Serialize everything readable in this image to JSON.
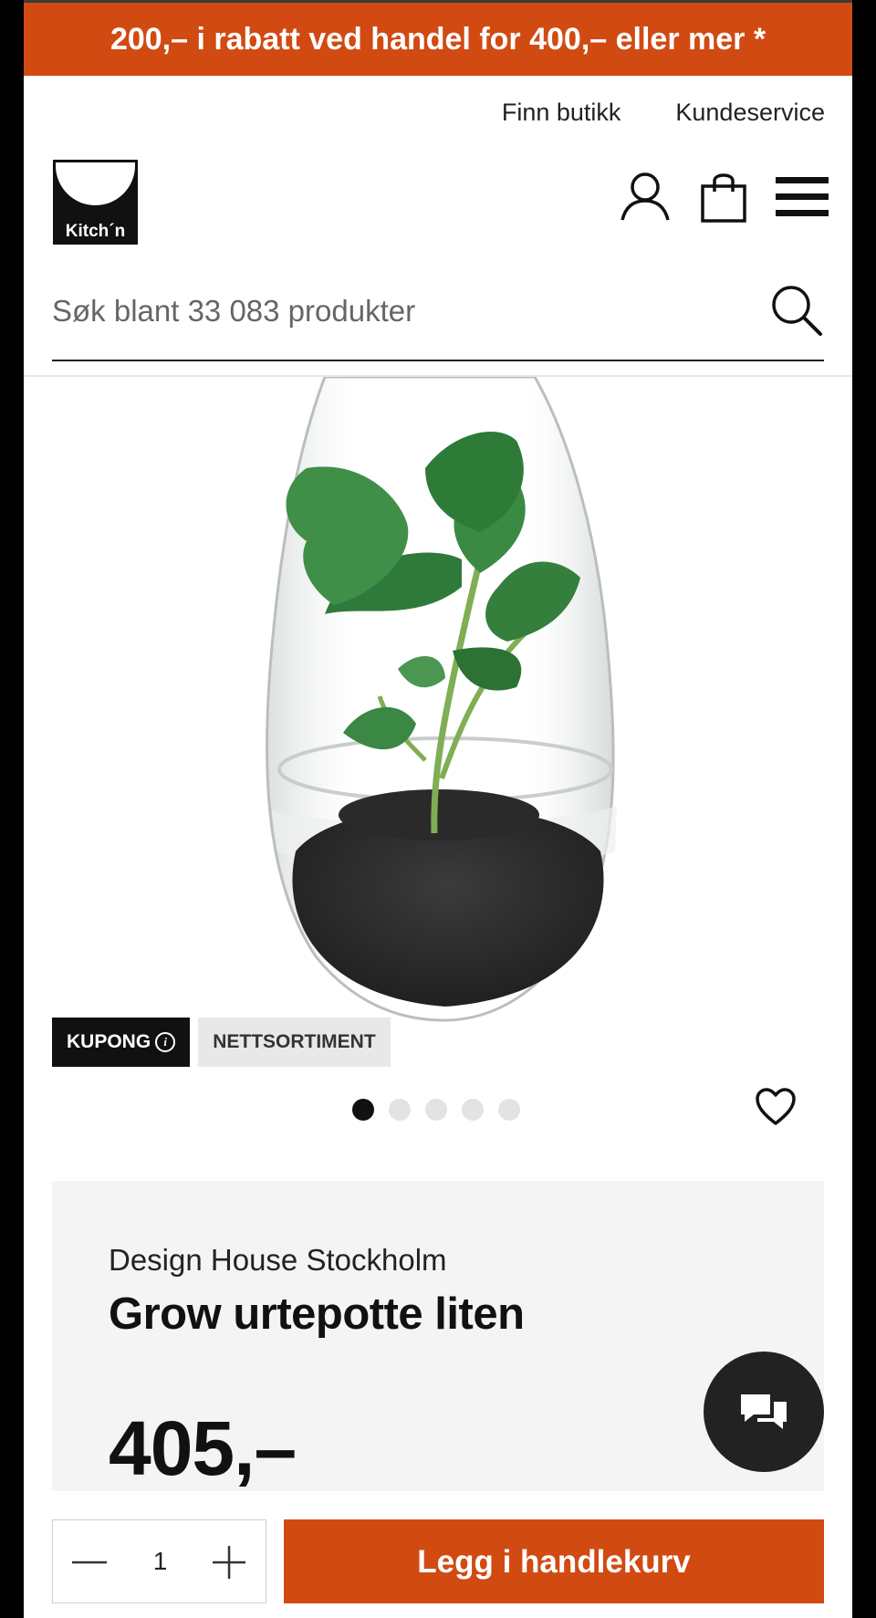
{
  "promo_banner": {
    "text": "200,– i rabatt ved handel for 400,– eller mer *"
  },
  "header": {
    "links": [
      "Finn butikk",
      "Kundeservice"
    ],
    "logo_text": "Kitch´n"
  },
  "search": {
    "placeholder": "Søk blant 33 083 produkter"
  },
  "icons": {
    "account": "user-icon",
    "cart": "shopping-bag-icon",
    "menu": "hamburger-menu-icon",
    "search": "search-icon",
    "favorite": "heart-icon",
    "chat": "chat-bubbles-icon",
    "decrease": "minus-icon",
    "increase": "plus-icon"
  },
  "product": {
    "badges": [
      "KUPONG",
      "NETTSORTIMENT"
    ],
    "image_count": 5,
    "active_image": 1,
    "brand": "Design House Stockholm",
    "name": "Grow urtepotte liten",
    "price": "405,–"
  },
  "purchase": {
    "quantity": "1",
    "add_to_cart_label": "Legg i handlekurv"
  },
  "colors": {
    "accent": "#d14a12",
    "dark": "#111111",
    "card_bg": "#f4f4f4"
  }
}
